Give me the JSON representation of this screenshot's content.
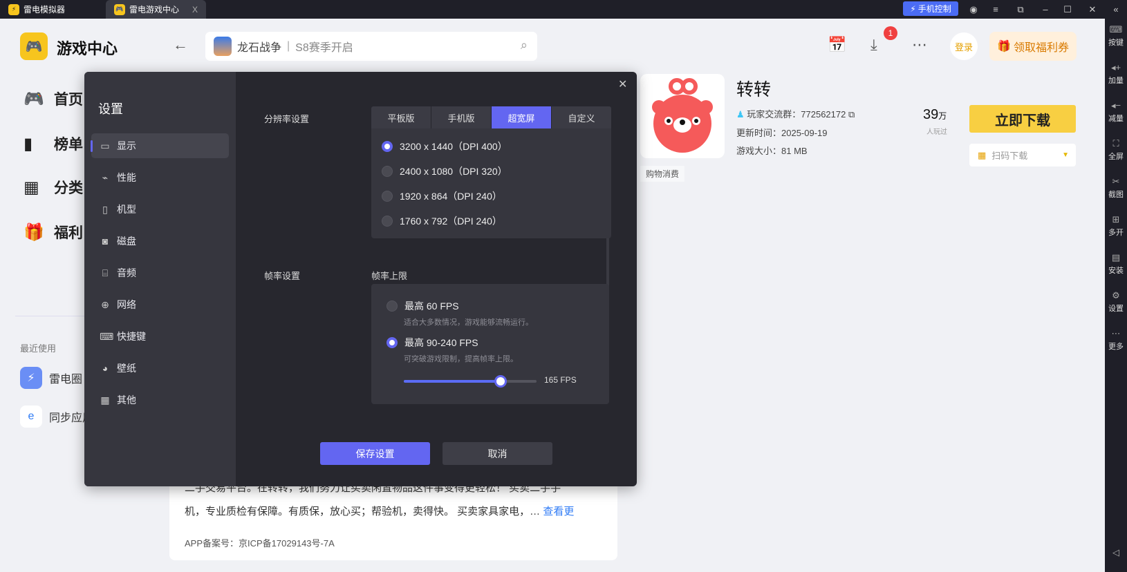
{
  "titlebar": {
    "tabs": [
      {
        "label": "雷电模拟器"
      },
      {
        "label": "雷电游戏中心",
        "close": "X"
      }
    ],
    "phone_control": "手机控制"
  },
  "right_sidebar": [
    {
      "label": "按键",
      "icon": "keyboard-icon"
    },
    {
      "label": "加量",
      "icon": "volume-up-icon"
    },
    {
      "label": "减量",
      "icon": "volume-down-icon"
    },
    {
      "label": "全屏",
      "icon": "fullscreen-icon"
    },
    {
      "label": "截图",
      "icon": "scissors-icon"
    },
    {
      "label": "多开",
      "icon": "multi-instance-icon"
    },
    {
      "label": "安装",
      "icon": "apk-icon"
    },
    {
      "label": "设置",
      "icon": "gear-icon"
    },
    {
      "label": "更多",
      "icon": "more-icon"
    }
  ],
  "header": {
    "app_title": "游戏中心",
    "search_game": "龙石战争",
    "search_sep": "|",
    "search_sub": "S8赛季开启",
    "download_badge": "1",
    "login": "登录",
    "welfare": "领取福利券"
  },
  "nav": [
    {
      "label": "首页"
    },
    {
      "label": "榜单"
    },
    {
      "label": "分类"
    },
    {
      "label": "福利"
    }
  ],
  "recent": {
    "title": "最近使用",
    "items": [
      {
        "label": "雷电圈"
      },
      {
        "label": "同步应用"
      }
    ]
  },
  "app": {
    "name": "转转",
    "group": "玩家交流群：772562172",
    "updated": "更新时间：2025-09-19",
    "size": "游戏大小：81 MB",
    "tag": "购物消费",
    "plays": "39",
    "plays_unit": "万",
    "plays_label": "人玩过",
    "download": "立即下载",
    "qr_download": "扫码下载",
    "desc1": "二手交易平台。在转转，我们努力让买卖闲置物品这件事变得更轻松！ 买卖二手手",
    "desc2": "机，专业质检有保障。有质保，放心买；帮验机，卖得快。 买卖家具家电，…",
    "more": "查看更",
    "icp": "APP备案号：京ICP备17029143号-7A"
  },
  "settings": {
    "title": "设置",
    "menu": [
      {
        "label": "显示",
        "icon": "monitor-icon"
      },
      {
        "label": "性能",
        "icon": "performance-icon"
      },
      {
        "label": "机型",
        "icon": "device-icon"
      },
      {
        "label": "磁盘",
        "icon": "disk-icon"
      },
      {
        "label": "音频",
        "icon": "audio-icon"
      },
      {
        "label": "网络",
        "icon": "globe-icon"
      },
      {
        "label": "快捷键",
        "icon": "keyboard-icon"
      },
      {
        "label": "壁纸",
        "icon": "palette-icon"
      },
      {
        "label": "其他",
        "icon": "grid-icon"
      }
    ],
    "resolution_label": "分辨率设置",
    "tabs": [
      "平板版",
      "手机版",
      "超宽屏",
      "自定义"
    ],
    "active_tab": 2,
    "resolutions": [
      "3200 x 1440（DPI 400）",
      "2400 x 1080（DPI 320）",
      "1920 x 864（DPI 240）",
      "1760 x 792（DPI 240）"
    ],
    "selected_resolution": 0,
    "fps_label": "帧率设置",
    "fps_limit_label": "帧率上限",
    "fps_options": [
      {
        "title": "最高 60 FPS",
        "desc": "适合大多数情况，游戏能够流畅运行。"
      },
      {
        "title": "最高 90-240 FPS",
        "desc": "可突破游戏限制，提高帧率上限。"
      }
    ],
    "selected_fps": 1,
    "fps_value": "165 FPS",
    "fps_slider_fraction": 0.73,
    "save": "保存设置",
    "cancel": "取消"
  },
  "accent": "#6366f1"
}
